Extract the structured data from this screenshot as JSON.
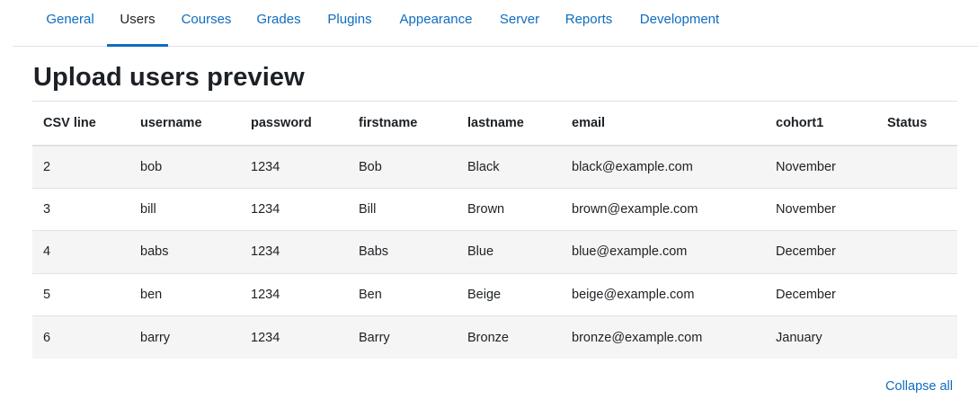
{
  "tabs": [
    {
      "label": "General"
    },
    {
      "label": "Users"
    },
    {
      "label": "Courses"
    },
    {
      "label": "Grades"
    },
    {
      "label": "Plugins"
    },
    {
      "label": "Appearance"
    },
    {
      "label": "Server"
    },
    {
      "label": "Reports"
    },
    {
      "label": "Development"
    }
  ],
  "active_tab": "Users",
  "page_title": "Upload users preview",
  "table": {
    "headers": [
      "CSV line",
      "username",
      "password",
      "firstname",
      "lastname",
      "email",
      "cohort1",
      "Status"
    ],
    "rows": [
      [
        "2",
        "bob",
        "1234",
        "Bob",
        "Black",
        "black@example.com",
        "November",
        ""
      ],
      [
        "3",
        "bill",
        "1234",
        "Bill",
        "Brown",
        "brown@example.com",
        "November",
        ""
      ],
      [
        "4",
        "babs",
        "1234",
        "Babs",
        "Blue",
        "blue@example.com",
        "December",
        ""
      ],
      [
        "5",
        "ben",
        "1234",
        "Ben",
        "Beige",
        "beige@example.com",
        "December",
        ""
      ],
      [
        "6",
        "barry",
        "1234",
        "Barry",
        "Bronze",
        "bronze@example.com",
        "January",
        ""
      ]
    ]
  },
  "collapse_all_label": "Collapse all",
  "colors": {
    "link": "#0f6cbf",
    "text": "#1d2125",
    "stripe": "#f5f5f5",
    "border": "#dee2e6"
  }
}
